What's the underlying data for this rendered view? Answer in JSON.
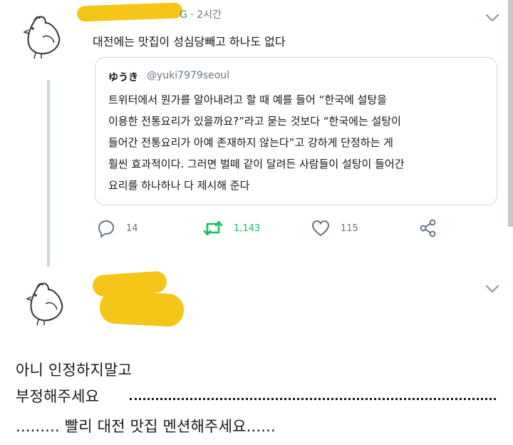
{
  "tweet": {
    "meta": "G · 2시간",
    "text": "대전에는 맛집이 성심당빼고 하나도 없다",
    "quote": {
      "name": "ゆうき",
      "handle": "@yuki7979seoul",
      "lines": [
        "트위터에서 뭔가를 알아내려고 할 때 예를 들어 “한국에 설탕을",
        "이용한 전통요리가 있을까요?”라고 묻는 것보다 “한국에는 설탕이",
        "들어간 전통요리가 아예 존재하지 않는다”고 강하게 단정하는 게",
        "훨씬 효과적이다. 그러면 벌떼 같이 달려든 사람들이 설탕이 들어간",
        "요리를 하나하나 다 제시해 준다"
      ]
    },
    "actions": {
      "reply_count": "14",
      "retweet_count": "1,143",
      "like_count": "115"
    }
  },
  "reply": {
    "lines": [
      "아니 인정하지말고",
      "부정해주세요",
      "......... 빨리 대전 맛집 멘션해주세요......"
    ]
  },
  "colors": {
    "redaction": "#f5c518",
    "retweet_green": "#17bf63",
    "muted_gray": "#657786",
    "border": "#ccd6dd"
  }
}
